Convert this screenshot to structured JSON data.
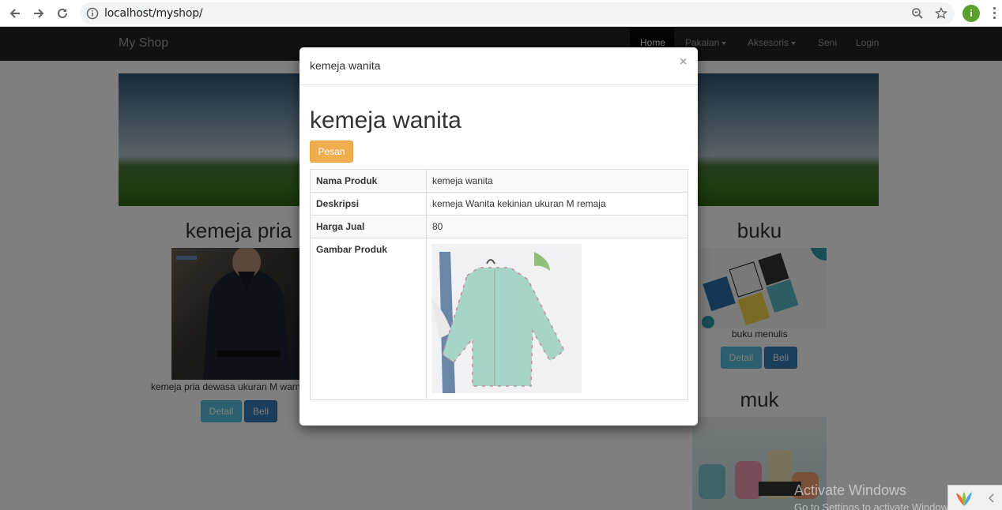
{
  "browser": {
    "url": "localhost/myshop/",
    "profile_initial": "i"
  },
  "navbar": {
    "brand": "My Shop",
    "items": [
      {
        "label": "Home"
      },
      {
        "label": "Pakaian"
      },
      {
        "label": "Aksesoris"
      },
      {
        "label": "Seni"
      },
      {
        "label": "Login"
      }
    ]
  },
  "products": {
    "kemeja_pria": {
      "title": "kemeja pria",
      "desc": "kemeja pria dewasa ukuran M warn",
      "detail": "Detail",
      "beli": "Beli"
    },
    "buku": {
      "title": "buku",
      "desc": "buku menulis",
      "detail": "Detail",
      "beli": "Beli"
    },
    "muk": {
      "title": "muk"
    }
  },
  "modal": {
    "header_title": "kemeja wanita",
    "close": "×",
    "heading": "kemeja wanita",
    "order_button": "Pesan",
    "rows": [
      {
        "label": "Nama Produk",
        "value": "kemeja wanita"
      },
      {
        "label": "Deskripsi",
        "value": "kemeja Wanita kekinian ukuran M remaja"
      },
      {
        "label": "Harga Jual",
        "value": "80"
      },
      {
        "label": "Gambar Produk",
        "value": ""
      }
    ]
  },
  "watermark": {
    "line1": "Activate Windows",
    "line2": "Go to Settings to activate Windows."
  }
}
